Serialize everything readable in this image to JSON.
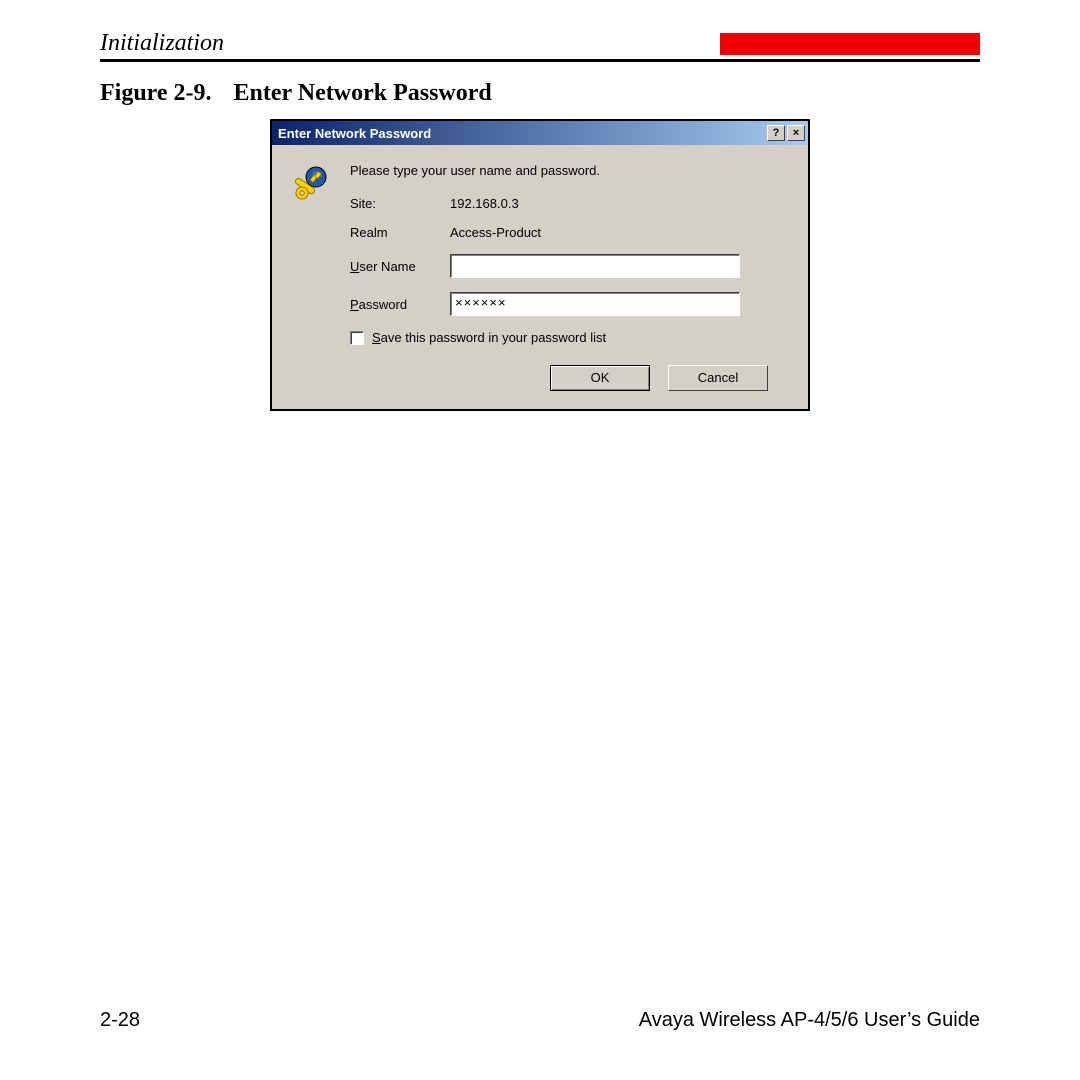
{
  "header": {
    "section": "Initialization"
  },
  "figure": {
    "number": "Figure 2-9.",
    "title": "Enter Network Password"
  },
  "dialog": {
    "title": "Enter Network Password",
    "help_btn": "?",
    "close_btn": "×",
    "instruction": "Please type your user name and password.",
    "site_label": "Site:",
    "site_value": "192.168.0.3",
    "realm_label": "Realm",
    "realm_value": "Access-Product",
    "username_label_pre": "",
    "username_u": "U",
    "username_label_post": "ser Name",
    "username_value": "",
    "password_u": "P",
    "password_label_post": "assword",
    "password_value": "××××××",
    "save_u": "S",
    "save_label_post": "ave this password in your password list",
    "ok": "OK",
    "cancel": "Cancel"
  },
  "footer": {
    "page": "2-28",
    "guide": "Avaya Wireless AP-4/5/6 User’s Guide"
  }
}
